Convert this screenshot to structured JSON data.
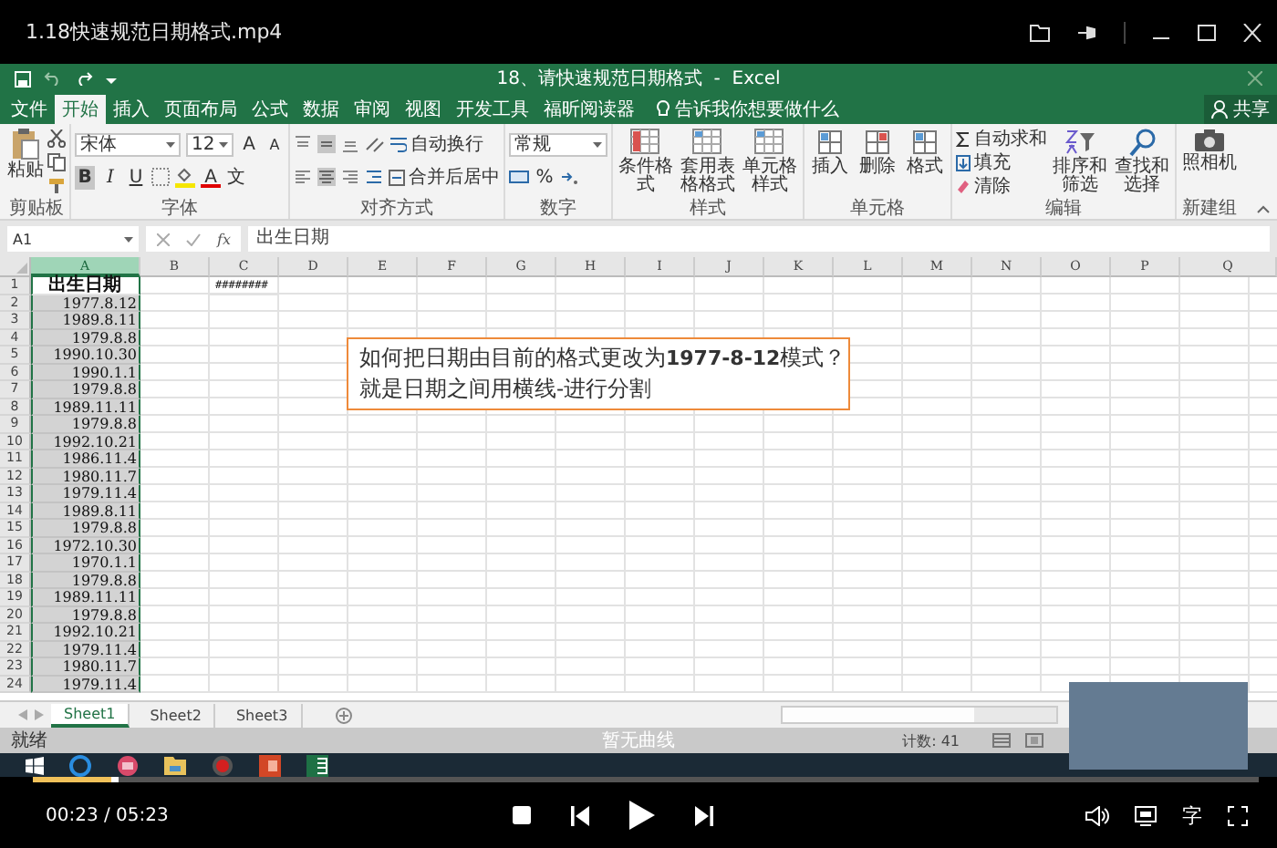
{
  "player": {
    "title": "1.18快速规范日期格式.mp4"
  },
  "excel": {
    "title": "18、请快速规范日期格式  -  Excel",
    "tabs": [
      {
        "label": "文件",
        "selected": false
      },
      {
        "label": "开始",
        "selected": true
      },
      {
        "label": "插入",
        "selected": false
      },
      {
        "label": "页面布局",
        "selected": false
      },
      {
        "label": "公式",
        "selected": false
      },
      {
        "label": "数据",
        "selected": false
      },
      {
        "label": "审阅",
        "selected": false
      },
      {
        "label": "视图",
        "selected": false
      },
      {
        "label": "开发工具",
        "selected": false
      },
      {
        "label": "福昕阅读器",
        "selected": false
      }
    ],
    "tell_me": "告诉我你想要做什么",
    "share": "共享"
  },
  "ribbon": {
    "clipboard": {
      "paste": "粘贴",
      "label": "剪贴板"
    },
    "font": {
      "name": "宋体",
      "size": "12",
      "grow": "A",
      "shrink": "A",
      "bold": "B",
      "italic": "I",
      "underline": "U",
      "font_color": "A",
      "phonetic": "文",
      "label": "字体"
    },
    "alignment": {
      "wrap": "自动换行",
      "merge": "合并后居中",
      "label": "对齐方式"
    },
    "number": {
      "format": "常规",
      "percent": "%",
      "label": "数字"
    },
    "styles": {
      "buttons": [
        "条件格式",
        "套用表格格式",
        "单元格样式"
      ],
      "label": "样式"
    },
    "cells": {
      "buttons": [
        "插入",
        "删除",
        "格式"
      ],
      "label": "单元格"
    },
    "editing": {
      "autosum": "自动求和",
      "fill": "填充",
      "clear": "清除",
      "sort": "排序和筛选",
      "find": "查找和选择",
      "label": "编辑"
    },
    "new_group": {
      "camera": "照相机",
      "label": "新建组"
    }
  },
  "formula_bar": {
    "name_box": "A1",
    "fx": "fx",
    "formula": "出生日期"
  },
  "columns": [
    {
      "label": "A",
      "selected": true
    },
    {
      "label": "B",
      "selected": false
    },
    {
      "label": "C",
      "selected": false
    },
    {
      "label": "D",
      "selected": false
    },
    {
      "label": "E",
      "selected": false
    },
    {
      "label": "F",
      "selected": false
    },
    {
      "label": "G",
      "selected": false
    },
    {
      "label": "H",
      "selected": false
    },
    {
      "label": "I",
      "selected": false
    },
    {
      "label": "J",
      "selected": false
    },
    {
      "label": "K",
      "selected": false
    },
    {
      "label": "L",
      "selected": false
    },
    {
      "label": "M",
      "selected": false
    },
    {
      "label": "N",
      "selected": false
    },
    {
      "label": "O",
      "selected": false
    },
    {
      "label": "P",
      "selected": false
    },
    {
      "label": "Q",
      "selected": false
    }
  ],
  "rows": [
    {
      "number": "1",
      "column_a": "出生日期",
      "column_c": "########"
    },
    {
      "number": "2",
      "column_a": "1977.8.12"
    },
    {
      "number": "3",
      "column_a": "1989.8.11"
    },
    {
      "number": "4",
      "column_a": "1979.8.8"
    },
    {
      "number": "5",
      "column_a": "1990.10.30"
    },
    {
      "number": "6",
      "column_a": "1990.1.1"
    },
    {
      "number": "7",
      "column_a": "1979.8.8"
    },
    {
      "number": "8",
      "column_a": "1989.11.11"
    },
    {
      "number": "9",
      "column_a": "1979.8.8"
    },
    {
      "number": "10",
      "column_a": "1992.10.21"
    },
    {
      "number": "11",
      "column_a": "1986.11.4"
    },
    {
      "number": "12",
      "column_a": "1980.11.7"
    },
    {
      "number": "13",
      "column_a": "1979.11.4"
    },
    {
      "number": "14",
      "column_a": "1989.8.11"
    },
    {
      "number": "15",
      "column_a": "1979.8.8"
    },
    {
      "number": "16",
      "column_a": "1972.10.30"
    },
    {
      "number": "17",
      "column_a": "1970.1.1"
    },
    {
      "number": "18",
      "column_a": "1979.8.8"
    },
    {
      "number": "19",
      "column_a": "1989.11.11"
    },
    {
      "number": "20",
      "column_a": "1979.8.8"
    },
    {
      "number": "21",
      "column_a": "1992.10.21"
    },
    {
      "number": "22",
      "column_a": "1979.11.4"
    },
    {
      "number": "23",
      "column_a": "1980.11.7"
    },
    {
      "number": "24",
      "column_a": "1979.11.4"
    }
  ],
  "callout": [
    "如何把日期由目前的格式更改为**1977-8-12**模式？",
    "就是日期之间用横线-进行分割"
  ],
  "sheets": [
    {
      "label": "Sheet1",
      "selected": true
    },
    {
      "label": "Sheet2",
      "selected": false
    },
    {
      "label": "Sheet3",
      "selected": false
    }
  ],
  "status_bar": {
    "ready": "就绪",
    "count": "计数: 41"
  },
  "overlay_caption": "暂无曲线",
  "playback": {
    "time": "00:23 / 05:23",
    "level": 0.07,
    "subtitle": "字"
  }
}
